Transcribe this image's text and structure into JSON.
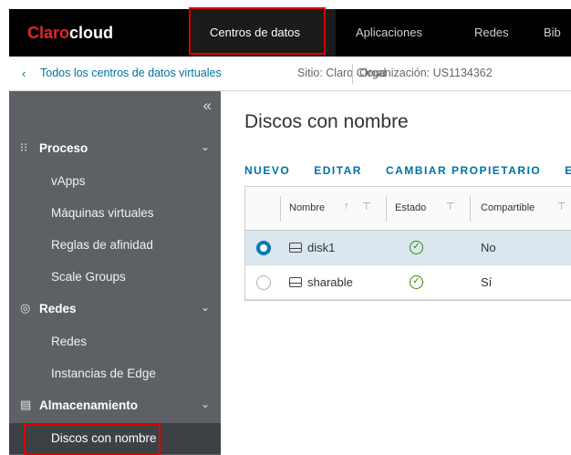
{
  "brand": {
    "claro": "Claro",
    "cloud": "cloud"
  },
  "topnav": {
    "tabs": [
      {
        "label": "Centros de datos",
        "active": true
      },
      {
        "label": "Aplicaciones",
        "active": false
      },
      {
        "label": "Redes",
        "active": false
      },
      {
        "label": "Bib",
        "active": false
      }
    ]
  },
  "breadcrumb": {
    "back_label": "Todos los centros de datos virtuales",
    "site": "Sitio: Claro Cloud",
    "organization": "Organización: US1134362"
  },
  "sidebar": {
    "collapse_icon": "«",
    "sections": [
      {
        "label": "Proceso",
        "icon": "grid-icon",
        "items": [
          "vApps",
          "Máquinas virtuales",
          "Reglas de afinidad",
          "Scale Groups"
        ]
      },
      {
        "label": "Redes",
        "icon": "network-icon",
        "items": [
          "Redes",
          "Instancias de Edge"
        ]
      },
      {
        "label": "Almacenamiento",
        "icon": "storage-icon",
        "items": [
          "Discos con nombre"
        ]
      }
    ],
    "active_item": "Discos con nombre"
  },
  "main": {
    "title": "Discos con nombre",
    "actions": [
      "NUEVO",
      "EDITAR",
      "CAMBIAR PROPIETARIO",
      "EL"
    ],
    "columns": [
      {
        "label": "Nombre",
        "sort": "↑"
      },
      {
        "label": "Estado"
      },
      {
        "label": "Compartible"
      }
    ],
    "rows": [
      {
        "name": "disk1",
        "status": "ok",
        "shareable": "No",
        "selected": true
      },
      {
        "name": "sharable",
        "status": "ok",
        "shareable": "Sí",
        "selected": false
      }
    ]
  },
  "colors": {
    "brand_red": "#e5252a",
    "link_blue": "#0072a3",
    "sidebar_bg": "#5d6166",
    "selected_row": "#dbe7ef",
    "status_green": "#3c8500",
    "annotation_red": "#e00000"
  }
}
